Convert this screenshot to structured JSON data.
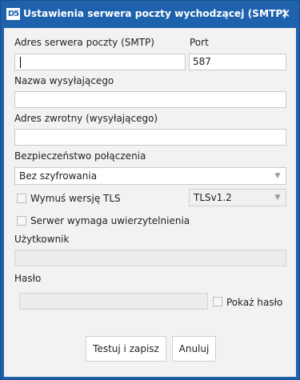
{
  "window": {
    "logo_text": "D5",
    "title": "Ustawienia serwera poczty wychodzącej (SMTP)",
    "close_glyph": "✕"
  },
  "form": {
    "smtp_server": {
      "label": "Adres serwera poczty (SMTP)",
      "value": ""
    },
    "port": {
      "label": "Port",
      "value": "587"
    },
    "sender_name": {
      "label": "Nazwa wysyłającego",
      "value": ""
    },
    "reply_address": {
      "label": "Adres zwrotny (wysyłającego)",
      "value": ""
    },
    "security": {
      "label": "Bezpieczeństwo połączenia",
      "selected": "Bez szyfrowania"
    },
    "force_tls": {
      "label": "Wymuś wersję TLS",
      "checked": false,
      "version_selected": "TLSv1.2"
    },
    "requires_auth": {
      "label": "Serwer wymaga uwierzytelnienia",
      "checked": false
    },
    "user": {
      "label": "Użytkownik",
      "value": ""
    },
    "password": {
      "label": "Hasło",
      "value": "",
      "show_label": "Pokaż hasło",
      "show_checked": false
    }
  },
  "buttons": {
    "test_save": "Testuj i zapisz",
    "cancel": "Anuluj"
  },
  "icons": {
    "close": "close-icon",
    "dropdown": "chevron-down-icon"
  },
  "colors": {
    "titlebar": "#1e62ad",
    "panel": "#f2f2f2"
  }
}
